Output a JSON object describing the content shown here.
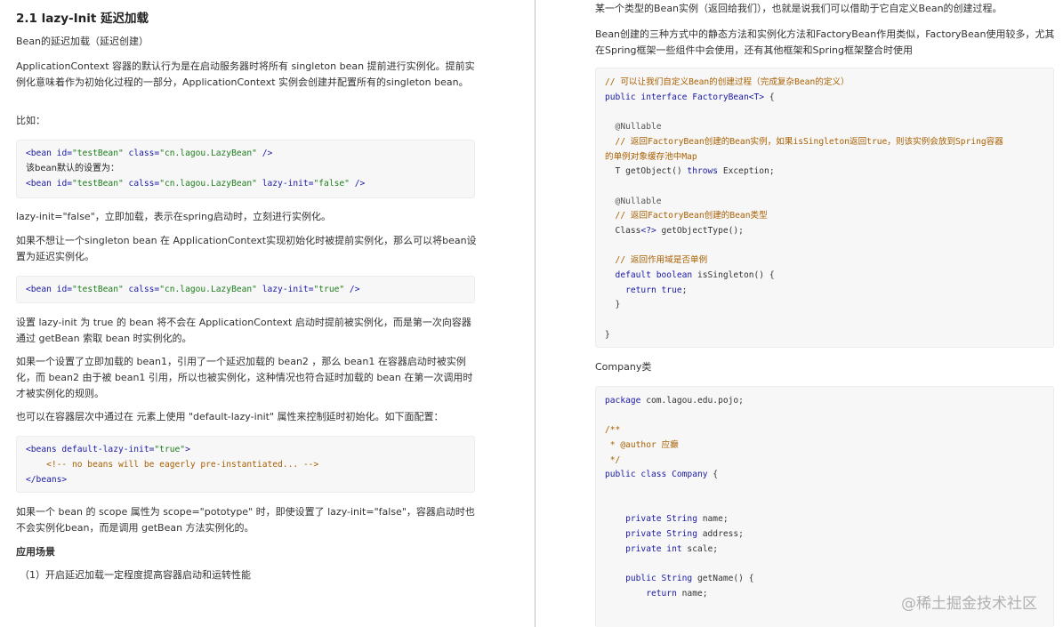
{
  "left": {
    "heading": "2.1 lazy-Init 延迟加载",
    "p1": "Bean的延迟加载（延迟创建）",
    "p2": "ApplicationContext 容器的默认行为是在启动服务器时将所有 singleton bean 提前进行实例化。提前实例化意味着作为初始化过程的一部分，ApplicationContext 实例会创建并配置所有的singleton bean。",
    "p3": "比如：",
    "code1": {
      "l1": {
        "tag": "<bean",
        "a1": " id=",
        "v1": "\"testBean\"",
        "a2": " class=",
        "v2": "\"cn.lagou.LazyBean\"",
        "end": " />"
      },
      "l2": "该bean默认的设置为：",
      "l3": {
        "tag": "<bean",
        "a1": " id=",
        "v1": "\"testBean\"",
        "a2": " calss=",
        "v2": "\"cn.lagou.LazyBean\"",
        "a3": " lazy-init=",
        "v3": "\"false\"",
        "end": " />"
      }
    },
    "p4": "lazy-init=\"false\"，立即加载，表示在spring启动时，立刻进行实例化。",
    "p5": "如果不想让一个singleton bean 在 ApplicationContext实现初始化时被提前实例化，那么可以将bean设置为延迟实例化。",
    "code2": {
      "tag": "<bean",
      "a1": " id=",
      "v1": "\"testBean\"",
      "a2": " calss=",
      "v2": "\"cn.lagou.LazyBean\"",
      "a3": " lazy-init=",
      "v3": "\"true\"",
      "end": " />"
    },
    "p6": "设置 lazy-init 为 true 的 bean 将不会在 ApplicationContext 启动时提前被实例化，而是第一次向容器通过 getBean 索取 bean 时实例化的。",
    "p7": "如果一个设置了立即加载的 bean1，引用了一个延迟加载的 bean2 ，那么 bean1 在容器启动时被实例化，而 bean2 由于被 bean1 引用，所以也被实例化，这种情况也符合延时加载的 bean 在第一次调用时才被实例化的规则。",
    "p8": "也可以在容器层次中通过在 元素上使用 \"default-lazy-init\" 属性来控制延时初始化。如下面配置：",
    "code3": {
      "l1tag": "<beans",
      "l1attr": " default-lazy-init=",
      "l1val": "\"true\"",
      "l1end": ">",
      "l2": "    <!-- no beans will be eagerly pre-instantiated... -->",
      "l3": "</beans>"
    },
    "p9": "如果一个 bean 的 scope 属性为 scope=\"pototype\" 时，即使设置了 lazy-init=\"false\"，容器启动时也不会实例化bean，而是调用 getBean 方法实例化的。",
    "p10": "应用场景",
    "p11": "（1）开启延迟加载一定程度提高容器启动和运转性能"
  },
  "right": {
    "p1": "某一个类型的Bean实例（返回给我们），也就是说我们可以借助于它自定义Bean的创建过程。",
    "p2": "Bean创建的三种方式中的静态方法和实例化方法和FactoryBean作用类似，FactoryBean使用较多，尤其在Spring框架一些组件中会使用，还有其他框架和Spring框架整合时使用",
    "code1": {
      "l1": "// 可以让我们自定义Bean的创建过程（完成复杂Bean的定义）",
      "l2a": "public interface",
      "l2b": " FactoryBean",
      "l2c": "<T>",
      "l2d": " {",
      "l3": "  @Nullable",
      "l4": "  // 返回FactoryBean创建的Bean实例，如果isSingleton返回true，则该实例会放到Spring容器",
      "l5": "的单例对象缓存池中Map",
      "l6a": "  T getObject() ",
      "l6b": "throws",
      "l6c": " Exception;",
      "l7": "  @Nullable",
      "l8": "  // 返回FactoryBean创建的Bean类型",
      "l9a": "  Class",
      "l9b": "<?>",
      "l9c": " getObjectType();",
      "l10": "  // 返回作用域是否单例",
      "l11a": "  default boolean",
      "l11b": " isSingleton() {",
      "l12a": "    return true",
      "l12b": ";",
      "l13": "  }",
      "l14": "}"
    },
    "p3": "Company类",
    "code2": {
      "l1a": "package",
      "l1b": " com.lagou.edu.pojo;",
      "l2": "/**",
      "l3": " * @author 应癫",
      "l4": " */",
      "l5a": "public class",
      "l5b": " Company",
      "l5c": " {",
      "l6a": "    private String",
      "l6b": " name;",
      "l7a": "    private String",
      "l7b": " address;",
      "l8a": "    private int",
      "l8b": " scale;",
      "l9a": "    public String",
      "l9b": " getName() {",
      "l10a": "        return",
      "l10b": " name;"
    }
  },
  "watermark": "@稀土掘金技术社区"
}
